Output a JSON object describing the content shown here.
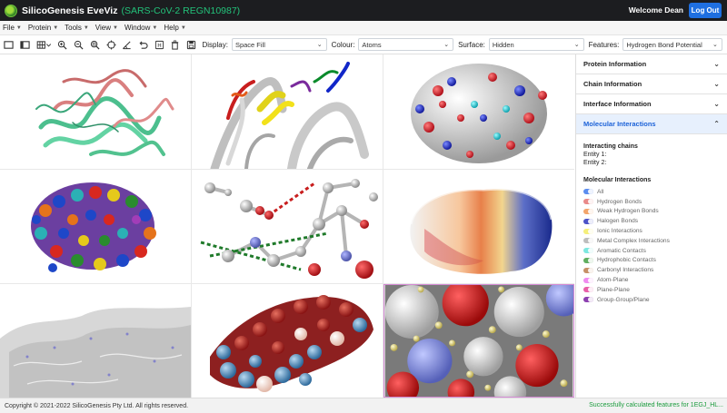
{
  "app": {
    "title": "SilicoGenesis EveViz",
    "subtitle": "(SARS-CoV-2 REGN10987)",
    "welcome": "Welcome Dean",
    "logout_label": "Log Out"
  },
  "menu": [
    {
      "label": "File"
    },
    {
      "label": "Protein"
    },
    {
      "label": "Tools"
    },
    {
      "label": "View"
    },
    {
      "label": "Window"
    },
    {
      "label": "Help"
    }
  ],
  "toolbar": {
    "display_label": "Display:",
    "display_value": "Space Fill",
    "colour_label": "Colour:",
    "colour_value": "Atoms",
    "surface_label": "Surface:",
    "surface_value": "Hidden",
    "features_label": "Features:",
    "features_value": "Hydrogen Bond Potential",
    "tools": [
      "single-view-icon",
      "dual-view-icon",
      "grid-view-icon",
      "zoom-in-icon",
      "zoom-out-icon",
      "zoom-fit-icon",
      "target-icon",
      "measure-icon",
      "undo-icon",
      "hydrogen-icon",
      "delete-icon",
      "save-icon"
    ]
  },
  "panel": {
    "sections": [
      {
        "label": "Protein Information",
        "expanded": false
      },
      {
        "label": "Chain Information",
        "expanded": false
      },
      {
        "label": "Interface Information",
        "expanded": false
      },
      {
        "label": "Molecular Interactions",
        "expanded": true
      }
    ],
    "interacting_chains_title": "Interacting chains",
    "entity1": "Entity 1:",
    "entity2": "Entity 2:",
    "molecular_interactions_title": "Molecular Interactions",
    "interactions": [
      {
        "label": "All",
        "color": "#5b8def"
      },
      {
        "label": "Hydrogen Bonds",
        "color": "#e98a8a"
      },
      {
        "label": "Weak Hydrogen Bonds",
        "color": "#f3a56b"
      },
      {
        "label": "Halogen Bonds",
        "color": "#4b52c8"
      },
      {
        "label": "Ionic Interactions",
        "color": "#f5ef7a"
      },
      {
        "label": "Metal Complex Interactions",
        "color": "#bdbdbd"
      },
      {
        "label": "Aromatic Contacts",
        "color": "#7de8e0"
      },
      {
        "label": "Hydrophobic Contacts",
        "color": "#5fae5f"
      },
      {
        "label": "Carbonyl Interactions",
        "color": "#c69066"
      },
      {
        "label": "Atom-Plane",
        "color": "#f08cf0"
      },
      {
        "label": "Plane-Plane",
        "color": "#e85fa8"
      },
      {
        "label": "Group-Group/Plane",
        "color": "#8c3fb0"
      }
    ]
  },
  "status": {
    "copyright": "Copyright © 2021-2022 SilicoGenesis Pty Ltd. All rights reserved.",
    "message": "Successfully calculated features for 1EGJ_HL..."
  }
}
